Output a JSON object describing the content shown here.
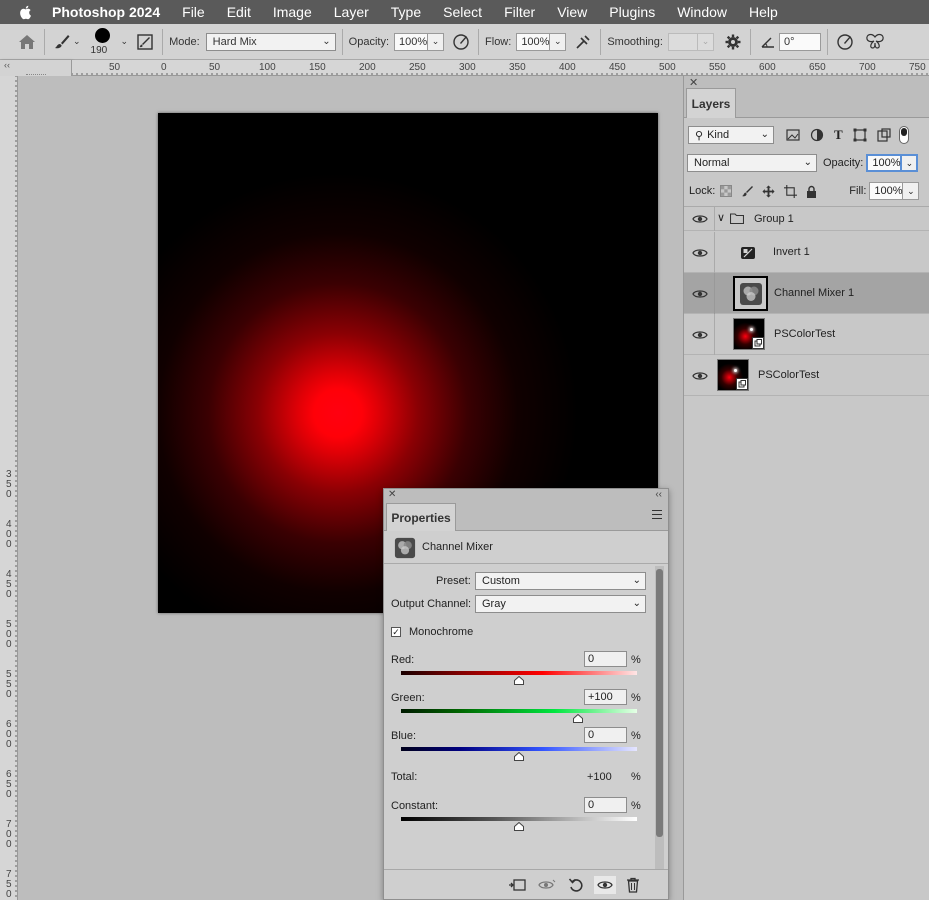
{
  "menubar": {
    "app": "Photoshop 2024",
    "items": [
      "File",
      "Edit",
      "Image",
      "Layer",
      "Type",
      "Select",
      "Filter",
      "View",
      "Plugins",
      "Window",
      "Help"
    ]
  },
  "options": {
    "brush_size": "190",
    "mode_label": "Mode:",
    "mode_value": "Hard Mix",
    "opacity_label": "Opacity:",
    "opacity_value": "100%",
    "flow_label": "Flow:",
    "flow_value": "100%",
    "smoothing_label": "Smoothing:",
    "smoothing_value": "",
    "angle_value": "0°"
  },
  "hruler": [
    "50",
    "0",
    "50",
    "100",
    "150",
    "200",
    "250",
    "300",
    "350",
    "400",
    "450",
    "500",
    "550",
    "600",
    "650",
    "700",
    "750"
  ],
  "vruler": [
    "3\n5\n0",
    "4\n0\n0",
    "4\n5\n0",
    "5\n0\n0",
    "5\n5\n0",
    "6\n0\n0",
    "6\n5\n0",
    "7\n0\n0",
    "7\n5\n0"
  ],
  "layers_panel": {
    "tab": "Layers",
    "filter": "Kind",
    "blend_mode": "Normal",
    "opacity_label": "Opacity:",
    "opacity_value": "100%",
    "lock_label": "Lock:",
    "fill_label": "Fill:",
    "fill_value": "100%",
    "layers": [
      {
        "name": "Group 1"
      },
      {
        "name": "Invert 1"
      },
      {
        "name": "Channel Mixer 1"
      },
      {
        "name": "PSColorTest"
      },
      {
        "name": "PSColorTest"
      }
    ]
  },
  "properties": {
    "tab": "Properties",
    "title": "Channel Mixer",
    "preset_label": "Preset:",
    "preset_value": "Custom",
    "output_label": "Output Channel:",
    "output_value": "Gray",
    "monochrome_label": "Monochrome",
    "monochrome_checked": true,
    "red_label": "Red:",
    "red_value": "0",
    "red_level": 0,
    "green_label": "Green:",
    "green_value": "+100",
    "green_level": 100,
    "blue_label": "Blue:",
    "blue_value": "0",
    "blue_level": 0,
    "total_label": "Total:",
    "total_value": "+100",
    "constant_label": "Constant:",
    "constant_value": "0",
    "constant_level": 0,
    "pct": "%"
  }
}
